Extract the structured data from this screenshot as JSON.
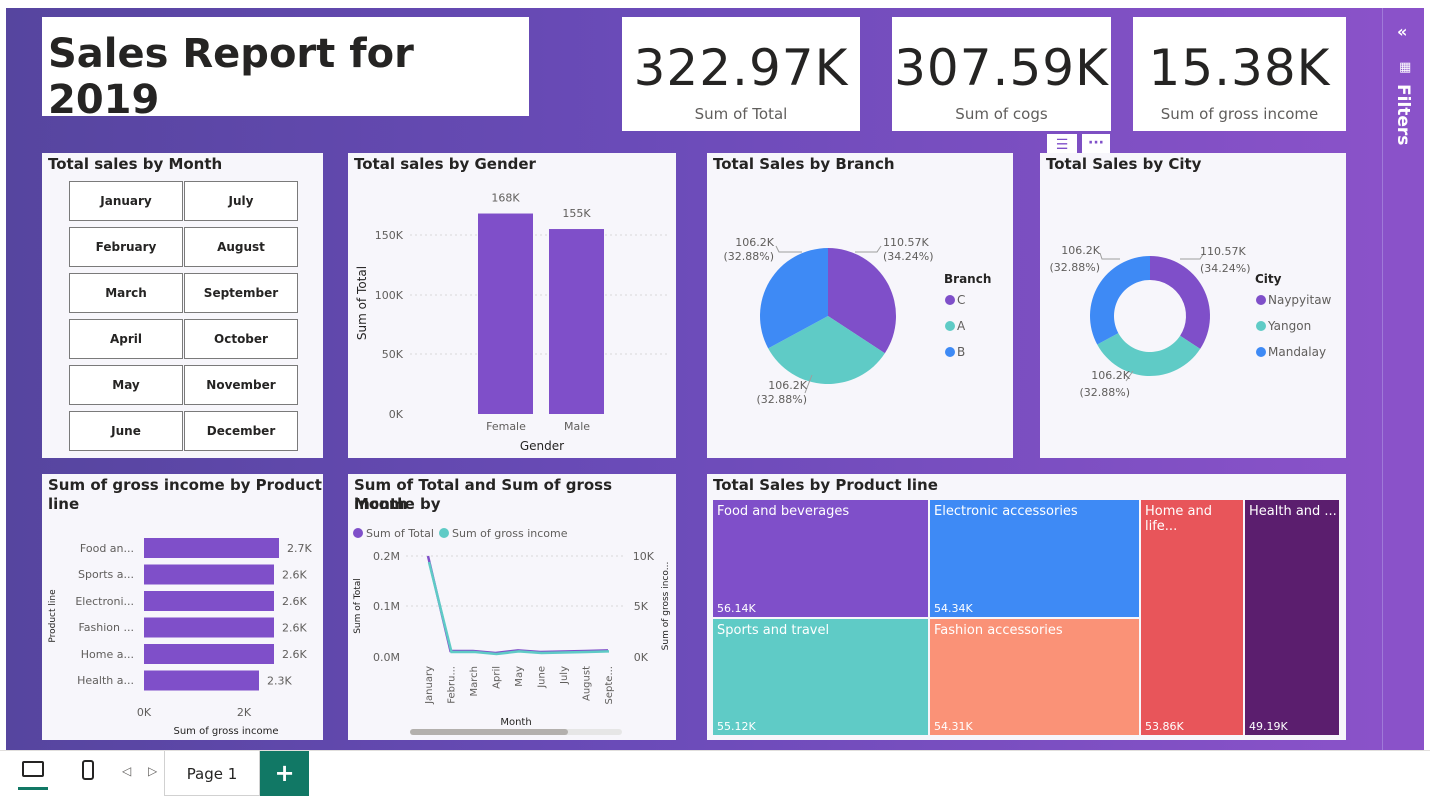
{
  "report": {
    "title": "Sales Report for 2019",
    "kpis": [
      {
        "value": "322.97K",
        "label": "Sum of Total"
      },
      {
        "value": "307.59K",
        "label": "Sum of cogs"
      },
      {
        "value": "15.38K",
        "label": "Sum of gross income"
      }
    ]
  },
  "month_slicer": {
    "title": "Total sales by Month",
    "months": [
      "January",
      "July",
      "February",
      "August",
      "March",
      "September",
      "April",
      "October",
      "May",
      "November",
      "June",
      "December"
    ]
  },
  "gender_chart": {
    "title": "Total sales by Gender",
    "xlabel": "Gender",
    "ylabel": "Sum of Total",
    "ticks": [
      "0K",
      "50K",
      "100K",
      "150K"
    ],
    "categories": [
      "Female",
      "Male"
    ],
    "labels": [
      "168K",
      "155K"
    ]
  },
  "branch_chart": {
    "title": "Total Sales by Branch",
    "legend_title": "Branch",
    "legend": [
      "C",
      "A",
      "B"
    ],
    "label_c": [
      "110.57K",
      "(34.24%)"
    ],
    "label_b": [
      "106.2K",
      "(32.88%)"
    ],
    "label_a": [
      "106.2K",
      "(32.88%)"
    ]
  },
  "city_chart": {
    "title": "Total Sales by City",
    "legend_title": "City",
    "legend": [
      "Naypyitaw",
      "Yangon",
      "Mandalay"
    ],
    "label_n": [
      "110.57K",
      "(34.24%)"
    ],
    "label_m": [
      "106.2K",
      "(32.88%)"
    ],
    "label_y": [
      "106.2K",
      "(32.88%)"
    ]
  },
  "product_income_chart": {
    "title_line1": "Sum of gross income by Product",
    "title_line2": "line",
    "xlabel": "Sum of gross income",
    "ylabel": "Product line",
    "xticks": [
      "0K",
      "2K"
    ],
    "categories": [
      "Food an...",
      "Sports a...",
      "Electroni...",
      "Fashion ...",
      "Home a...",
      "Health a..."
    ],
    "labels": [
      "2.7K",
      "2.6K",
      "2.6K",
      "2.6K",
      "2.6K",
      "2.3K"
    ]
  },
  "month_line_chart": {
    "title_line1": "Sum of Total and Sum of gross income by",
    "title_line2": "Month",
    "legend": [
      "Sum of Total",
      "Sum of gross income"
    ],
    "ylabel_left": "Sum of Total",
    "ylabel_right": "Sum of gross inco...",
    "left_ticks": [
      "0.0M",
      "0.1M",
      "0.2M"
    ],
    "right_ticks": [
      "0K",
      "5K",
      "10K"
    ],
    "xlabel": "Month",
    "months": [
      "January",
      "Febru...",
      "March",
      "April",
      "May",
      "June",
      "July",
      "August",
      "Septe..."
    ]
  },
  "treemap": {
    "title": "Total Sales by Product line",
    "tiles": [
      {
        "name": "Food and beverages",
        "value": "56.14K"
      },
      {
        "name": "Electronic accessories",
        "value": "54.34K"
      },
      {
        "name": "Home and life...",
        "value": "53.86K"
      },
      {
        "name": "Health and ...",
        "value": "49.19K"
      },
      {
        "name": "Sports and travel",
        "value": "55.12K"
      },
      {
        "name": "Fashion accessories",
        "value": "54.31K"
      }
    ]
  },
  "chart_data": [
    {
      "type": "bar",
      "title": "Total sales by Gender",
      "categories": [
        "Female",
        "Male"
      ],
      "values": [
        168000,
        155000
      ],
      "xlabel": "Gender",
      "ylabel": "Sum of Total",
      "ylim": [
        0,
        170000
      ]
    },
    {
      "type": "pie",
      "title": "Total Sales by Branch",
      "categories": [
        "C",
        "A",
        "B"
      ],
      "values": [
        110570,
        106200,
        106200
      ]
    },
    {
      "type": "pie",
      "title": "Total Sales by City",
      "categories": [
        "Naypyitaw",
        "Yangon",
        "Mandalay"
      ],
      "values": [
        110570,
        106200,
        106200
      ]
    },
    {
      "type": "bar",
      "title": "Sum of gross income by Product line",
      "categories": [
        "Food an...",
        "Sports a...",
        "Electroni...",
        "Fashion ...",
        "Home a...",
        "Health a..."
      ],
      "values": [
        2700,
        2600,
        2600,
        2600,
        2600,
        2300
      ],
      "xlabel": "Sum of gross income",
      "ylabel": "Product line"
    },
    {
      "type": "line",
      "title": "Sum of Total and Sum of gross income by Month",
      "categories": [
        "January",
        "Febru...",
        "March",
        "April",
        "May",
        "June",
        "July",
        "August",
        "Septe..."
      ],
      "series": [
        {
          "name": "Sum of Total",
          "values": [
            200000,
            12000,
            12000,
            8000,
            13000,
            10000,
            11000,
            12000,
            13000
          ]
        },
        {
          "name": "Sum of gross income",
          "values": [
            9500,
            600,
            600,
            400,
            650,
            500,
            550,
            600,
            650
          ]
        }
      ],
      "xlabel": "Month"
    },
    {
      "type": "heatmap",
      "title": "Total Sales by Product line",
      "categories": [
        "Food and beverages",
        "Sports and travel",
        "Electronic accessories",
        "Fashion accessories",
        "Home and life...",
        "Health and ..."
      ],
      "values": [
        56140,
        55120,
        54340,
        54310,
        53860,
        49190
      ]
    }
  ],
  "colors": {
    "purple": "#7f4fc9",
    "teal": "#5fcbc6",
    "blue": "#3e8af5",
    "salmon": "#fa9277",
    "red": "#e8555a",
    "dark_purple": "#5b1e6e"
  },
  "sidebar": {
    "filters_label": "Filters"
  },
  "bottom": {
    "page_tab": "Page 1",
    "add_label": "+"
  }
}
